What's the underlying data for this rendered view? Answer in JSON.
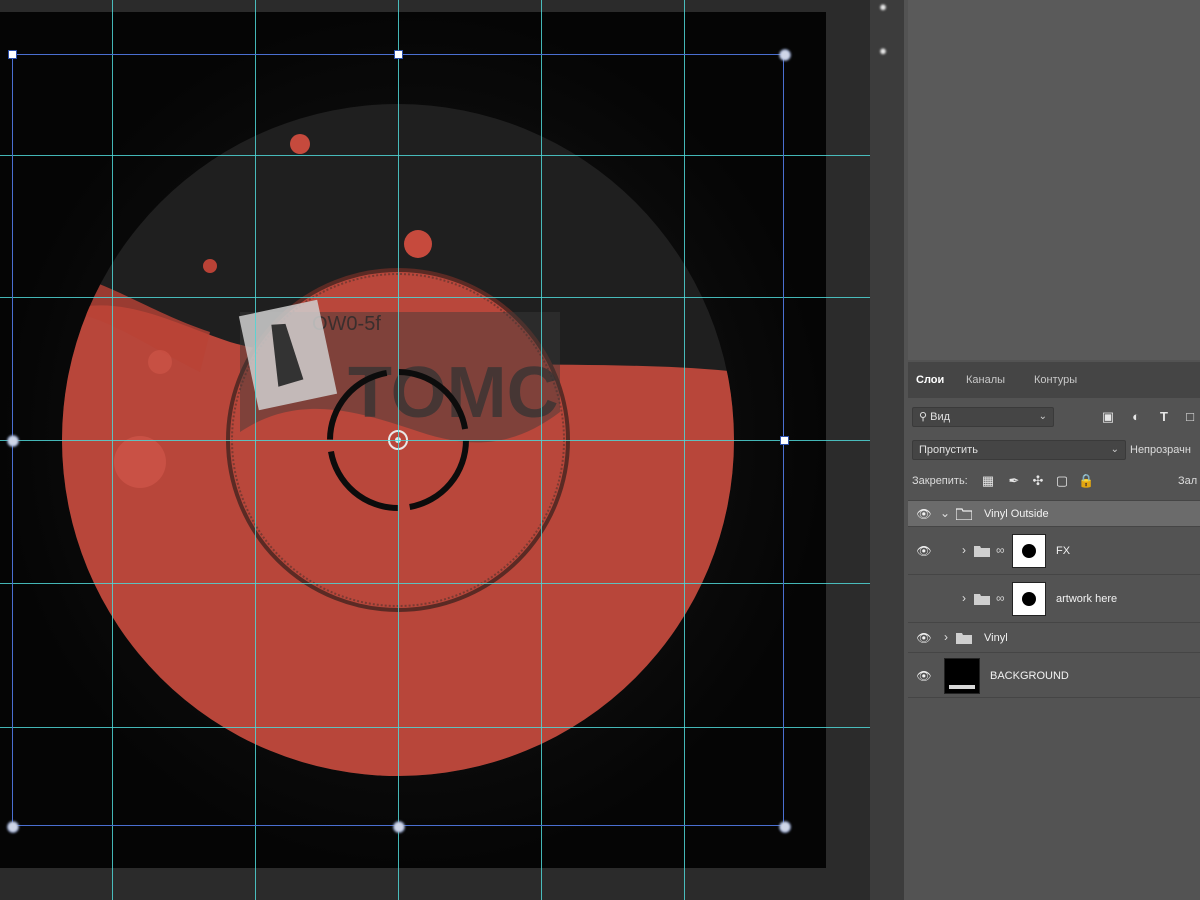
{
  "colors": {
    "guide": "#4fd6d6",
    "transform_box": "#4a6fd1",
    "vinyl_red": "#c9493b",
    "vinyl_black": "#1c1c1c",
    "panel_bg": "#535353"
  },
  "canvas": {
    "label_text_top": "OW0-5f",
    "label_text_main": "TOMC"
  },
  "layers_panel": {
    "tabs": [
      {
        "label": "Слои",
        "active": true
      },
      {
        "label": "Каналы",
        "active": false
      },
      {
        "label": "Контуры",
        "active": false
      }
    ],
    "filter": {
      "label": "Вид",
      "icon": "search-icon"
    },
    "filter_icons": [
      "image-filter-icon",
      "adjustment-filter-icon",
      "type-filter-icon",
      "shape-filter-icon"
    ],
    "blend_mode": "Пропустить",
    "opacity_label": "Непрозрачн",
    "lock_label": "Закрепить:",
    "lock_icons": [
      "lock-transparent-icon",
      "lock-paint-icon",
      "lock-move-icon",
      "lock-artboard-icon",
      "lock-all-icon"
    ],
    "fill_label": "Зал",
    "layers": [
      {
        "name": "Vinyl Outside",
        "type": "group",
        "expanded": true,
        "visible": true,
        "selected": true
      },
      {
        "name": "FX",
        "type": "group",
        "expanded": false,
        "visible": true,
        "has_mask": true
      },
      {
        "name": "artwork here",
        "type": "group",
        "expanded": false,
        "visible": false,
        "has_mask": true
      },
      {
        "name": "Vinyl",
        "type": "group",
        "expanded": false,
        "visible": true
      },
      {
        "name": "BACKGROUND",
        "type": "layer",
        "visible": true
      }
    ]
  }
}
